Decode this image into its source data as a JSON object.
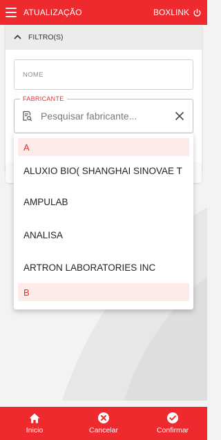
{
  "topbar": {
    "title": "ATUALIZAÇÃO",
    "right_label": "BOXLINK"
  },
  "filter": {
    "header_label": "FILTRO(S)",
    "nome_placeholder": "NOME",
    "fabricante_legend": "FABRICANTE",
    "fabricante_placeholder": "Pesquisar fabricante..."
  },
  "dropdown": {
    "groups": [
      {
        "letter": "A",
        "items": [
          "ALUXIO BIO( SHANGHAI SINOVAE T",
          "AMPULAB",
          "ANALISA",
          "ARTRON LABORATORIES INC"
        ]
      },
      {
        "letter": "B",
        "items": []
      }
    ]
  },
  "bottom_nav": {
    "home_label": "Inicio",
    "cancel_label": "Cancelar",
    "confirm_label": "Confirmar"
  },
  "icons": {
    "menu": "menu-icon",
    "power": "power-icon",
    "chevron": "chevron-up-icon",
    "search": "search-list-icon",
    "clear": "close-icon",
    "home": "home-icon",
    "cancel": "cancel-circle-icon",
    "confirm": "check-circle-icon"
  },
  "colors": {
    "accent": "#ee2a2e",
    "group_header_bg": "#fdebe7"
  }
}
